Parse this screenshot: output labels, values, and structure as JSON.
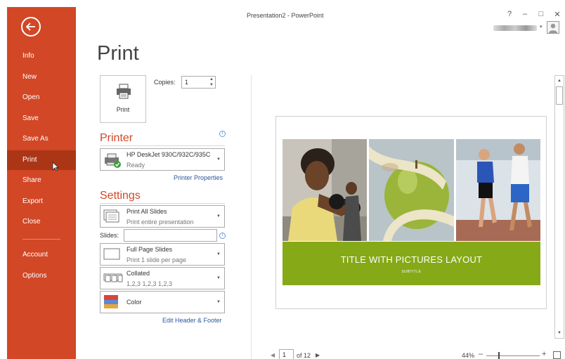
{
  "window": {
    "title": "Presentation2 - PowerPoint",
    "help_glyph": "?",
    "minimize_glyph": "–",
    "restore_glyph": "□",
    "close_glyph": "✕",
    "user_caret": "▾"
  },
  "sidebar": {
    "accent": "#d24726",
    "items": [
      {
        "label": "Info"
      },
      {
        "label": "New"
      },
      {
        "label": "Open"
      },
      {
        "label": "Save"
      },
      {
        "label": "Save As"
      },
      {
        "label": "Print",
        "active": true
      },
      {
        "label": "Share"
      },
      {
        "label": "Export"
      },
      {
        "label": "Close"
      },
      {
        "label": "Account"
      },
      {
        "label": "Options"
      }
    ]
  },
  "print": {
    "title": "Print",
    "button_label": "Print",
    "copies_label": "Copies:",
    "copies_value": "1",
    "spin_up": "▲",
    "spin_down": "▼"
  },
  "printer": {
    "section_title": "Printer",
    "info_glyph": "i",
    "name": "HP DeskJet 930C/932C/935C",
    "status": "Ready",
    "properties_link": "Printer Properties",
    "caret": "▼"
  },
  "settings": {
    "section_title": "Settings",
    "slides_range": {
      "main": "Print All Slides",
      "sub": "Print entire presentation"
    },
    "slides_label": "Slides:",
    "slides_value": "",
    "layout": {
      "main": "Full Page Slides",
      "sub": "Print 1 slide per page"
    },
    "collation": {
      "main": "Collated",
      "sub": "1,2,3   1,2,3   1,2,3"
    },
    "color": {
      "main": "Color"
    },
    "header_footer_link": "Edit Header & Footer"
  },
  "preview": {
    "slide_title": "TITLE WITH PICTURES LAYOUT",
    "slide_subtitle": "SUBTITLE",
    "band_color": "#86a918"
  },
  "scrollbar": {
    "up": "▲",
    "down": "▼"
  },
  "navigation": {
    "prev": "◀",
    "page_value": "1",
    "of_text": "of 12",
    "next": "▶",
    "zoom": "44%",
    "zoom_minus": "–",
    "zoom_plus": "+"
  }
}
